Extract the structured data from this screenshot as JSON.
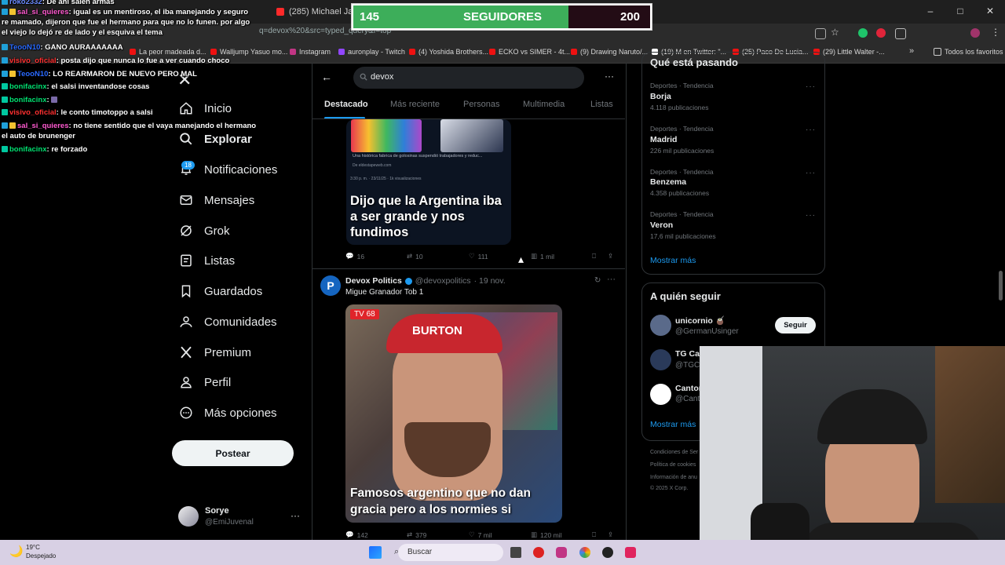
{
  "browser": {
    "tabs": [
      {
        "label": "(285) Michael Jackson -"
      }
    ],
    "url": "q=devox%20&src=typed_query&f=top",
    "bookmarks": [
      "La peor madeada d...",
      "Walljump Yasuo mo...",
      "Instagram",
      "auronplay - Twitch",
      "(4) Yoshida Brothers...",
      "ECKO vs SIMER - 4t...",
      "(9) Drawing Naruto/...",
      "(19) M en Twitter: \"...",
      "(25) Paco De Lucia...",
      "(29) Little Walter -..."
    ],
    "bookmarks_folder": "Todos los favoritos",
    "window_controls": [
      "–",
      "□",
      "✕"
    ]
  },
  "followers": {
    "current": "145",
    "label": "SEGUIDORES",
    "goal": "200",
    "progress": 0.725
  },
  "chat": [
    {
      "user": "roko2332",
      "msg": ": De ahi salen armas"
    },
    {
      "user": "sal_si_quieres",
      "msg": ": igual es un mentiroso, el iba manejando y seguro re mamado, dijeron que fue el hermano para que no lo funen. por algo el viejo lo dejó re de lado y el esquiva el tema"
    },
    {
      "user": "TeooN10",
      "msg": ": GANO AURAAAAAAA"
    },
    {
      "user": "visivo_oficial",
      "msg": ": posta dijo que nunca lo fue a ver cuando choco"
    },
    {
      "user": "TeooN10",
      "msg": ": LO REARMARON DE NUEVO PERO MAL"
    },
    {
      "user": "bonifacinx",
      "msg": ": el salsi inventandose cosas"
    },
    {
      "user": "bonifacinx",
      "msg": ": "
    },
    {
      "user": "visivo_oficial",
      "msg": ": le conto timotoppo a salsi"
    },
    {
      "user": "sal_si_quieres",
      "msg": ": no tiene sentido que el vaya manejando el hermano el auto de brunenger"
    },
    {
      "user": "bonifacinx",
      "msg": ": re forzado"
    }
  ],
  "nav": {
    "items": [
      "Inicio",
      "Explorar",
      "Notificaciones",
      "Mensajes",
      "Grok",
      "Listas",
      "Guardados",
      "Comunidades",
      "Premium",
      "Perfil",
      "Más opciones"
    ],
    "notif_count": "18",
    "post_label": "Postear",
    "user_name": "Sorye",
    "user_handle": "@EmiJuvenal"
  },
  "search": {
    "value": "devox"
  },
  "tabs": [
    "Destacado",
    "Más reciente",
    "Personas",
    "Multimedia",
    "Listas"
  ],
  "tweet1": {
    "img_caption": "Dijo que la Argentina iba a ser grande y nos fundimos",
    "img_small": "Una histórica fabrica de golosinas suspendió trabajadores y reduc...",
    "img_source": "De eldestapeweb.com",
    "img_meta": "3:30 p. m. · 23/11/25 · 1k visualizaciones",
    "replies": "16",
    "reposts": "10",
    "likes": "111",
    "views": "1 mil"
  },
  "tweet2": {
    "name": "Devox Politics",
    "handle": "@devoxpolitics",
    "date": "· 19 nov.",
    "text": "Migue Granador Tob 1",
    "tv_label": "TV",
    "tv_num": "68",
    "cap_text": "BURTON",
    "img_caption": "Famosos argentino que no dan gracia pero a los normies si",
    "replies": "142",
    "reposts": "379",
    "likes": "7 mil",
    "views": "120 mil"
  },
  "trends": {
    "title": "Qué está pasando",
    "items": [
      {
        "cat": "Deportes · Tendencia",
        "name": "Borja",
        "count": "4.118 publicaciones"
      },
      {
        "cat": "Deportes · Tendencia",
        "name": "Madrid",
        "count": "226 mil publicaciones"
      },
      {
        "cat": "Deportes · Tendencia",
        "name": "Benzema",
        "count": "4.358 publicaciones"
      },
      {
        "cat": "Deportes · Tendencia",
        "name": "Veron",
        "count": "17,6 mil publicaciones"
      }
    ],
    "more": "Mostrar más"
  },
  "follow": {
    "title": "A quién seguir",
    "users": [
      {
        "name": "unicornio 🧉",
        "handle": "@GermanUsinger"
      },
      {
        "name": "TG Car",
        "handle": "@TGCa"
      },
      {
        "name": "Canton",
        "handle": "@Cant"
      }
    ],
    "follow_label": "Seguir",
    "more": "Mostrar más"
  },
  "footer": [
    "Condiciones de Ser",
    "Política de cookies",
    "Información de anu",
    "© 2025 X Corp."
  ],
  "taskbar": {
    "weather_temp": "19°C",
    "weather_desc": "Despejado",
    "search_label": "Buscar"
  },
  "colors": {
    "accent": "#1d9bf0",
    "follow_green": "#3dae5a",
    "bg": "#000000"
  }
}
